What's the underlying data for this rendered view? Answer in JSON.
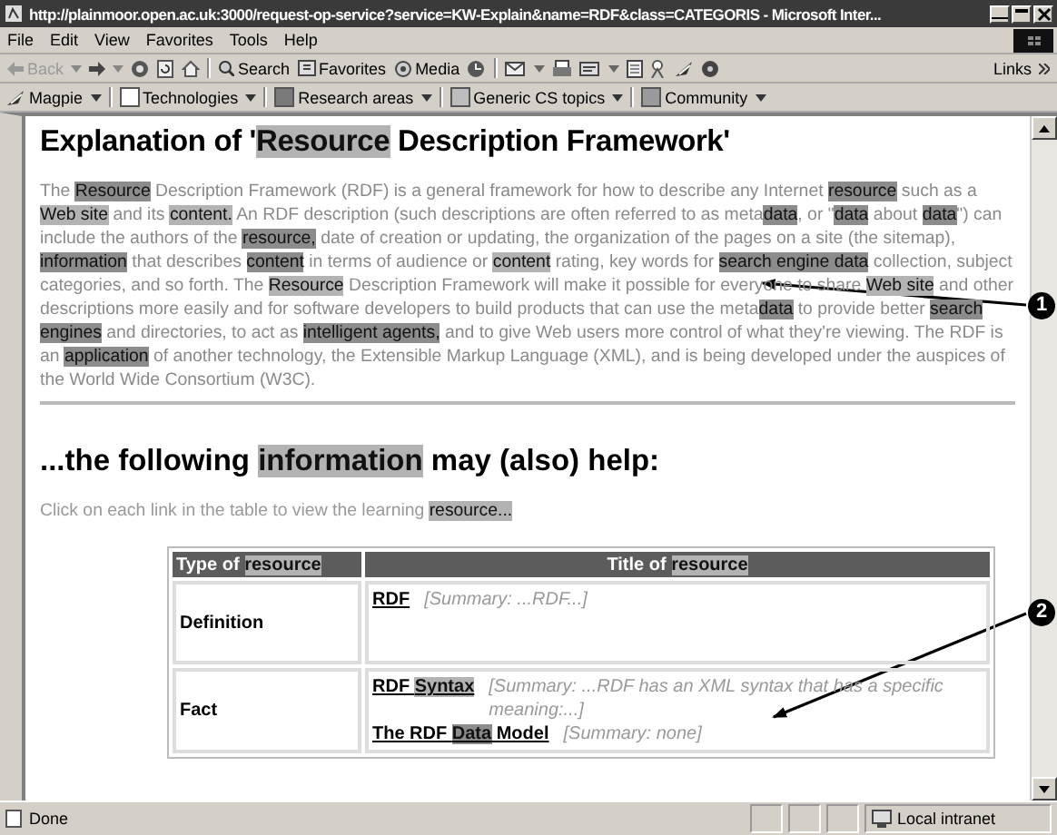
{
  "window": {
    "title": "http://plainmoor.open.ac.uk:3000/request-op-service?service=KW-Explain&name=RDF&class=CATEGORIS - Microsoft Inter..."
  },
  "menu": [
    "File",
    "Edit",
    "View",
    "Favorites",
    "Tools",
    "Help"
  ],
  "toolbar": {
    "back": "Back",
    "search": "Search",
    "favorites": "Favorites",
    "media": "Media",
    "links": "Links"
  },
  "magpie_bar": {
    "menu": "Magpie",
    "categories": [
      {
        "label": "Technologies",
        "color": "#ffffff"
      },
      {
        "label": "Research areas",
        "color": "#7a7a7a"
      },
      {
        "label": "Generic CS topics",
        "color": "#bdbdbd"
      },
      {
        "label": "Community",
        "color": "#9a9a9a"
      }
    ]
  },
  "page": {
    "heading": [
      {
        "text": "Explanation of '",
        "kind": "plain"
      },
      {
        "text": "Resource",
        "kind": "light"
      },
      {
        "text": " Description Framework'",
        "kind": "plain"
      }
    ],
    "paragraph": [
      {
        "text": "The ",
        "kind": "plain"
      },
      {
        "text": "Resource",
        "kind": "dark"
      },
      {
        "text": " Description Framework (RDF) is a general framework for how to describe any Internet ",
        "kind": "plain"
      },
      {
        "text": "resource",
        "kind": "dark"
      },
      {
        "text": " such as a ",
        "kind": "plain"
      },
      {
        "text": "Web site",
        "kind": "light"
      },
      {
        "text": " and its ",
        "kind": "plain"
      },
      {
        "text": "content.",
        "kind": "light"
      },
      {
        "text": " An RDF description (such descriptions are often referred to as meta",
        "kind": "plain"
      },
      {
        "text": "data",
        "kind": "dark"
      },
      {
        "text": ", or \"",
        "kind": "plain"
      },
      {
        "text": "data",
        "kind": "dark"
      },
      {
        "text": " about ",
        "kind": "plain"
      },
      {
        "text": "data",
        "kind": "dark"
      },
      {
        "text": "\") can include the authors of the ",
        "kind": "plain"
      },
      {
        "text": "resource,",
        "kind": "dark"
      },
      {
        "text": " date of creation or updating, the organization of the pages on a site (the sitemap), ",
        "kind": "plain"
      },
      {
        "text": "information",
        "kind": "dark"
      },
      {
        "text": " that describes ",
        "kind": "plain"
      },
      {
        "text": "content",
        "kind": "dark"
      },
      {
        "text": " in terms of audience or ",
        "kind": "plain"
      },
      {
        "text": "content",
        "kind": "light"
      },
      {
        "text": " rating, key words for ",
        "kind": "plain"
      },
      {
        "text": "search engine ",
        "kind": "dark"
      },
      {
        "text": "data",
        "kind": "dark"
      },
      {
        "text": " collection, subject categories, and so forth. The ",
        "kind": "plain"
      },
      {
        "text": "Resource",
        "kind": "light"
      },
      {
        "text": " Description Framework will make it possible for everyone to share ",
        "kind": "plain"
      },
      {
        "text": "Web site",
        "kind": "light"
      },
      {
        "text": " and other descriptions more easily and for software developers to build products that can use the meta",
        "kind": "plain"
      },
      {
        "text": "data",
        "kind": "dark"
      },
      {
        "text": " to provide better ",
        "kind": "plain"
      },
      {
        "text": "search engines",
        "kind": "dark"
      },
      {
        "text": " and directories, to act as ",
        "kind": "plain"
      },
      {
        "text": "intelligent agents,",
        "kind": "dark"
      },
      {
        "text": " and to give Web users more control of what they're viewing. The RDF is an ",
        "kind": "plain"
      },
      {
        "text": "application",
        "kind": "dark"
      },
      {
        "text": " of another technology, the Extensible Markup Language (XML), and is being developed under the auspices of the World Wide Consortium (W3C).",
        "kind": "plain"
      }
    ],
    "subheading": [
      {
        "text": "...the following ",
        "kind": "plain"
      },
      {
        "text": "information",
        "kind": "light"
      },
      {
        "text": " may (also) help:",
        "kind": "plain"
      }
    ],
    "instruction": [
      {
        "text": "Click on each link in the table to view the learning ",
        "kind": "plain"
      },
      {
        "text": "resource...",
        "kind": "light"
      }
    ],
    "table": {
      "columns": [
        [
          {
            "text": "Type of ",
            "kind": "plain"
          },
          {
            "text": "resource",
            "kind": "light"
          }
        ],
        [
          {
            "text": "Title of ",
            "kind": "plain"
          },
          {
            "text": "resource",
            "kind": "light"
          }
        ]
      ],
      "rows": [
        {
          "type": "Definition",
          "links": [
            {
              "title": [
                {
                  "text": "RDF",
                  "kind": "plain"
                }
              ],
              "summary": "[Summary: ...RDF...]"
            }
          ]
        },
        {
          "type": "Fact",
          "links": [
            {
              "title": [
                {
                  "text": "RDF ",
                  "kind": "plain"
                },
                {
                  "text": "Syntax",
                  "kind": "light"
                }
              ],
              "summary": "[Summary: ...RDF has an XML syntax that has a specific meaning:...]"
            },
            {
              "title": [
                {
                  "text": "The RDF ",
                  "kind": "plain"
                },
                {
                  "text": "Data",
                  "kind": "dark"
                },
                {
                  "text": " Model",
                  "kind": "plain"
                }
              ],
              "summary": "[Summary: none]"
            }
          ]
        }
      ]
    }
  },
  "callouts": [
    "1",
    "2"
  ],
  "status_bar": {
    "status": "Done",
    "zone": "Local intranet"
  }
}
